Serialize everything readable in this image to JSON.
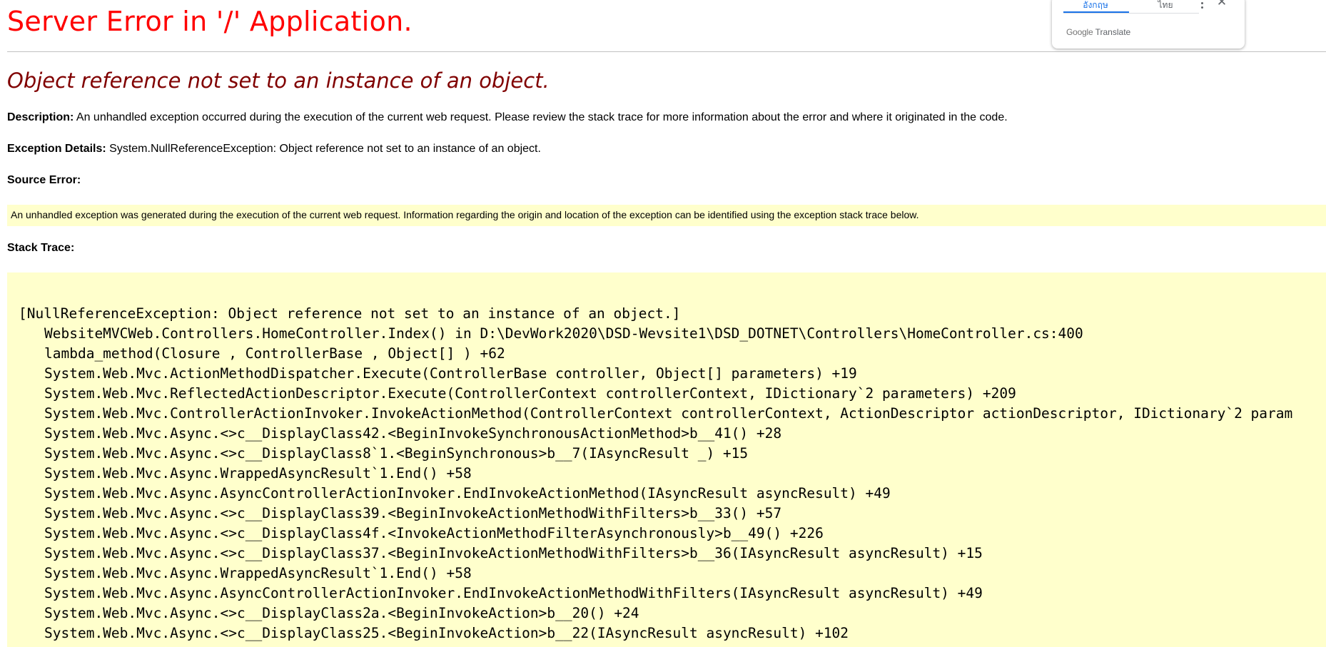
{
  "page": {
    "title": "Server Error in '/' Application.",
    "subtitle": "Object reference not set to an instance of an object.",
    "description_label": "Description:",
    "description_text": "An unhandled exception occurred during the execution of the current web request. Please review the stack trace for more information about the error and where it originated in the code.",
    "exception_label": "Exception Details:",
    "exception_text": "System.NullReferenceException: Object reference not set to an instance of an object.",
    "source_error_label": "Source Error:",
    "source_error_text": "An unhandled exception was generated during the execution of the current web request. Information regarding the origin and location of the exception can be identified using the exception stack trace below.",
    "stack_trace_label": "Stack Trace:"
  },
  "stack_trace": {
    "header": "[NullReferenceException: Object reference not set to an instance of an object.]",
    "lines": [
      "WebsiteMVCWeb.Controllers.HomeController.Index() in D:\\DevWork2020\\DSD-Wevsite1\\DSD_DOTNET\\Controllers\\HomeController.cs:400",
      "lambda_method(Closure , ControllerBase , Object[] ) +62",
      "System.Web.Mvc.ActionMethodDispatcher.Execute(ControllerBase controller, Object[] parameters) +19",
      "System.Web.Mvc.ReflectedActionDescriptor.Execute(ControllerContext controllerContext, IDictionary`2 parameters) +209",
      "System.Web.Mvc.ControllerActionInvoker.InvokeActionMethod(ControllerContext controllerContext, ActionDescriptor actionDescriptor, IDictionary`2 param",
      "System.Web.Mvc.Async.<>c__DisplayClass42.<BeginInvokeSynchronousActionMethod>b__41() +28",
      "System.Web.Mvc.Async.<>c__DisplayClass8`1.<BeginSynchronous>b__7(IAsyncResult _) +15",
      "System.Web.Mvc.Async.WrappedAsyncResult`1.End() +58",
      "System.Web.Mvc.Async.AsyncControllerActionInvoker.EndInvokeActionMethod(IAsyncResult asyncResult) +49",
      "System.Web.Mvc.Async.<>c__DisplayClass39.<BeginInvokeActionMethodWithFilters>b__33() +57",
      "System.Web.Mvc.Async.<>c__DisplayClass4f.<InvokeActionMethodFilterAsynchronously>b__49() +226",
      "System.Web.Mvc.Async.<>c__DisplayClass37.<BeginInvokeActionMethodWithFilters>b__36(IAsyncResult asyncResult) +15",
      "System.Web.Mvc.Async.WrappedAsyncResult`1.End() +58",
      "System.Web.Mvc.Async.AsyncControllerActionInvoker.EndInvokeActionMethodWithFilters(IAsyncResult asyncResult) +49",
      "System.Web.Mvc.Async.<>c__DisplayClass2a.<BeginInvokeAction>b__20() +24",
      "System.Web.Mvc.Async.<>c__DisplayClass25.<BeginInvokeAction>b__22(IAsyncResult asyncResult) +102"
    ]
  },
  "translate_widget": {
    "tab_active": "อังกฤษ",
    "tab_other": "ไทย",
    "brand_google": "Google",
    "brand_translate": "Translate",
    "more_icon": "more-vert-icon",
    "close_icon": "close-icon",
    "accent_color": "#1a73e8"
  },
  "colors": {
    "title": "#ff0000",
    "subtitle": "#800000",
    "code_background": "#ffffcc"
  }
}
